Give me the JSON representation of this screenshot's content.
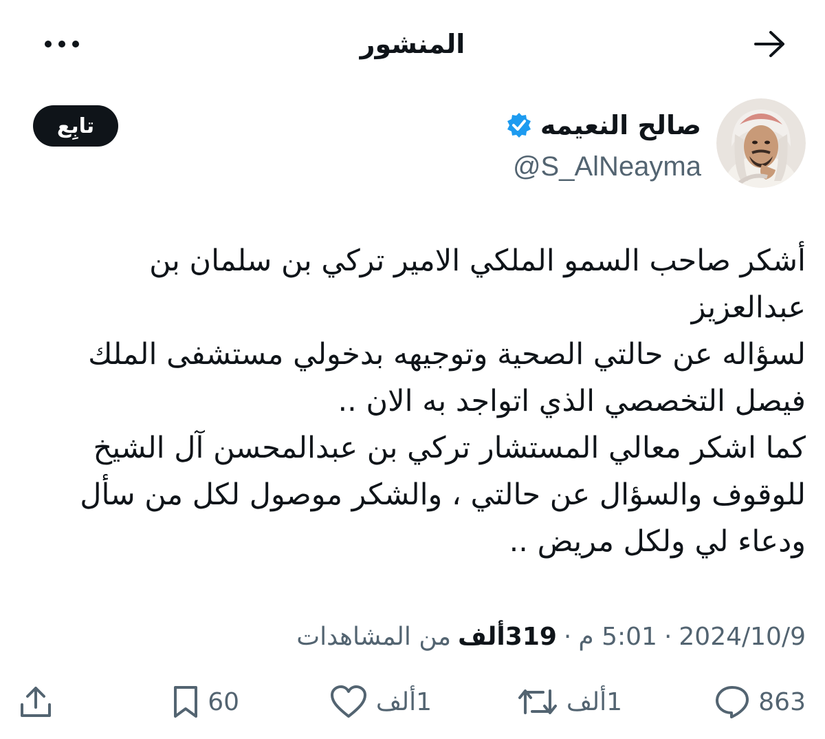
{
  "header": {
    "title": "المنشور",
    "back_icon": "arrow-right-icon",
    "more_icon": "more-horizontal-icon"
  },
  "author": {
    "display_name": "صالح النعيمه",
    "handle": "@S_AlNeayma",
    "verified": true,
    "verified_color": "#1d9bf0"
  },
  "follow_button": {
    "label": "تابِع"
  },
  "tweet": {
    "text": "أشكر صاحب السمو الملكي الامير تركي بن سلمان بن\nعبدالعزيز\nلسؤاله عن حالتي الصحية وتوجيهه بدخولي مستشفى الملك\nفيصل التخصصي الذي اتواجد به الان ..\nكما اشكر معالي المستشار تركي بن عبدالمحسن آل الشيخ\nللوقوف والسؤال عن حالتي ، والشكر موصول لكل من سأل\nودعاء لي ولكل مريض .."
  },
  "meta": {
    "date": "2024/10/9",
    "time": "5:01 م",
    "views_count": "319ألف",
    "views_label": "من المشاهدات",
    "separator": "·"
  },
  "actions": {
    "replies": "863",
    "reposts": "1ألف",
    "likes": "1ألف",
    "bookmarks": "60"
  },
  "colors": {
    "text_primary": "#0f1419",
    "text_secondary": "#536471",
    "follow_bg": "#0f1419",
    "verified": "#1d9bf0"
  }
}
